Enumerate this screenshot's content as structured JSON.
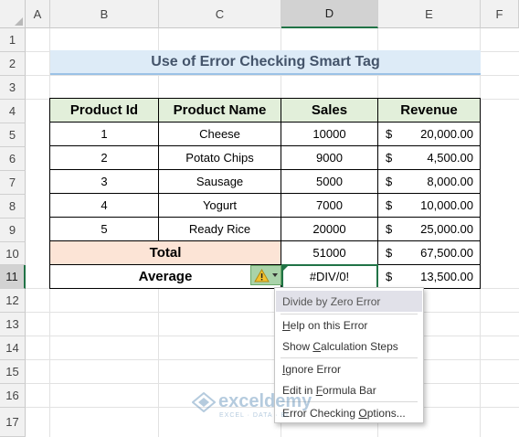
{
  "columns": [
    "A",
    "B",
    "C",
    "D",
    "E",
    "F"
  ],
  "rows": [
    "1",
    "2",
    "3",
    "4",
    "5",
    "6",
    "7",
    "8",
    "9",
    "10",
    "11",
    "12",
    "13",
    "14",
    "15",
    "16",
    "17"
  ],
  "selected_column": "D",
  "selected_row": "11",
  "title": "Use of Error Checking Smart Tag",
  "table": {
    "headers": [
      "Product Id",
      "Product Name",
      "Sales",
      "Revenue"
    ],
    "rows": [
      {
        "id": "1",
        "name": "Cheese",
        "sales": "10000",
        "currency": "$",
        "revenue": "20,000.00"
      },
      {
        "id": "2",
        "name": "Potato Chips",
        "sales": "9000",
        "currency": "$",
        "revenue": "4,500.00"
      },
      {
        "id": "3",
        "name": "Sausage",
        "sales": "5000",
        "currency": "$",
        "revenue": "8,000.00"
      },
      {
        "id": "4",
        "name": "Yogurt",
        "sales": "7000",
        "currency": "$",
        "revenue": "10,000.00"
      },
      {
        "id": "5",
        "name": "Ready Rice",
        "sales": "20000",
        "currency": "$",
        "revenue": "25,000.00"
      }
    ],
    "total": {
      "label": "Total",
      "sales": "51000",
      "currency": "$",
      "revenue": "67,500.00"
    },
    "average": {
      "label": "Average",
      "sales": "#DIV/0!",
      "currency": "$",
      "revenue": "13,500.00"
    }
  },
  "smart_tag": {
    "icon": "warning-icon",
    "dropdown_icon": "chevron-down-icon"
  },
  "error_menu": {
    "header": "Divide by Zero Error",
    "help": {
      "pre": "",
      "key": "H",
      "post": "elp on this Error"
    },
    "calc": {
      "pre": "Show ",
      "key": "C",
      "post": "alculation Steps"
    },
    "ignore": {
      "pre": "",
      "key": "I",
      "post": "gnore Error"
    },
    "edit": {
      "pre": "Edit in ",
      "key": "F",
      "post": "ormula Bar"
    },
    "options": {
      "pre": "Error Checking ",
      "key": "O",
      "post": "ptions..."
    }
  },
  "watermark": {
    "name": "exceldemy",
    "tagline": "EXCEL · DATA · BI"
  },
  "colors": {
    "accent": "#217346",
    "title_bg": "#ddebf7",
    "header_bg": "#e2efda",
    "total_bg": "#fce4d6"
  }
}
